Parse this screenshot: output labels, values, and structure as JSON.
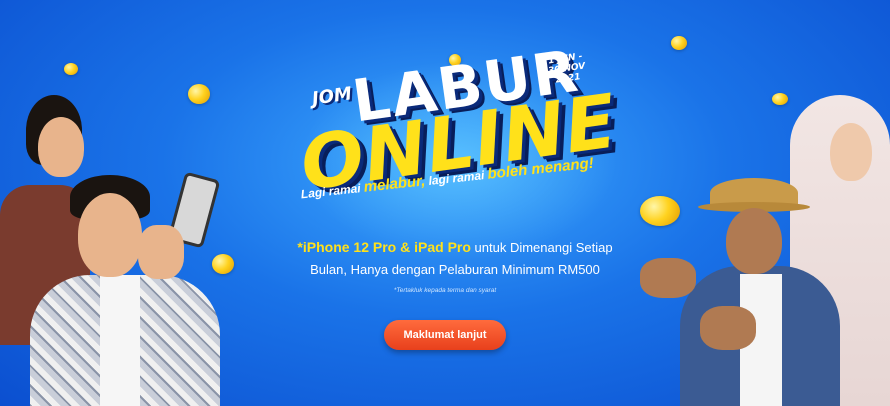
{
  "title": {
    "jom": "JOM",
    "labur": "LABUR",
    "online": "ONLINE"
  },
  "date_badge": {
    "line1": "1 JUN -",
    "line2": "30 NOV",
    "line3": "2021"
  },
  "tagline": {
    "part1": "Lagi ramai ",
    "highlight1": "melabur,",
    "part2": " lagi ramai ",
    "highlight2": "boleh menang!"
  },
  "promo": {
    "highlight": "*iPhone 12 Pro & iPad Pro",
    "line1_rest": "  untuk Dimenangi Setiap",
    "line2": "Bulan, Hanya dengan Pelaburan Minimum RM500"
  },
  "disclaimer": "*Tertakluk kepada terma dan syarat",
  "cta_label": "Maklumat lanjut",
  "colors": {
    "background": "#1a73e8",
    "accent_yellow": "#ffe11a",
    "cta": "#e8401c"
  }
}
